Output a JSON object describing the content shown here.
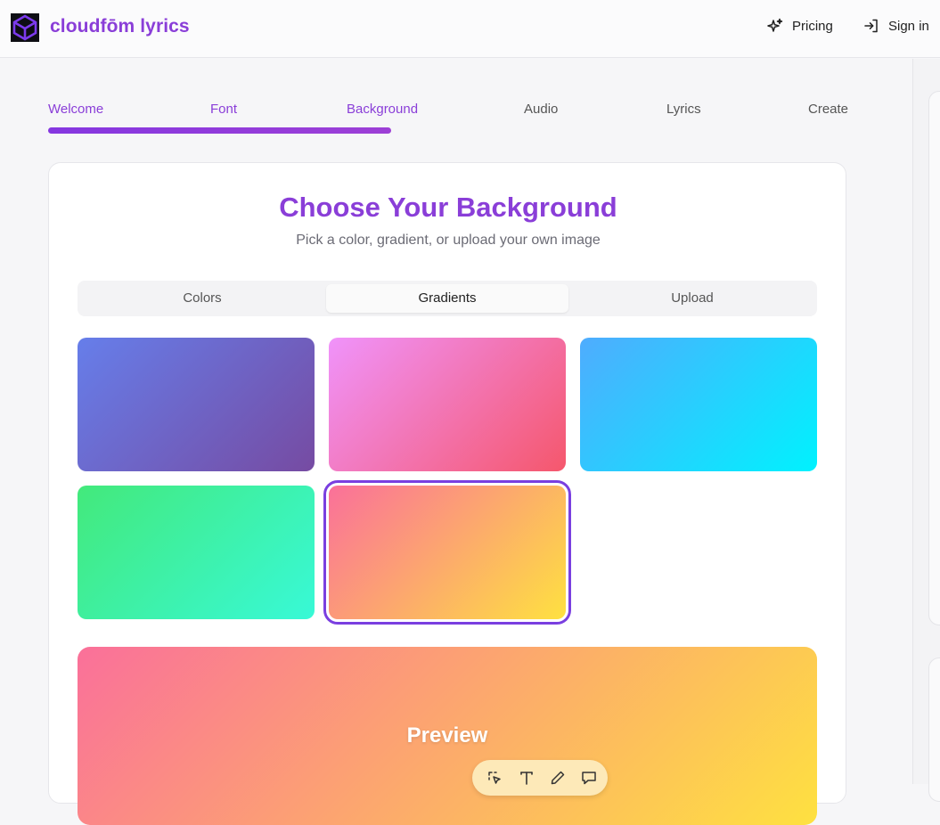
{
  "header": {
    "brand": "cloudfōm lyrics",
    "pricing_label": "Pricing",
    "signin_label": "Sign in"
  },
  "steps": {
    "items": [
      {
        "label": "Welcome",
        "state": "done"
      },
      {
        "label": "Font",
        "state": "done"
      },
      {
        "label": "Background",
        "state": "current"
      },
      {
        "label": "Audio",
        "state": "todo"
      },
      {
        "label": "Lyrics",
        "state": "todo"
      },
      {
        "label": "Create",
        "state": "todo"
      }
    ],
    "progress_fraction": 0.43
  },
  "main": {
    "title": "Choose Your Background",
    "subtitle": "Pick a color, gradient, or upload your own image",
    "tabs": [
      {
        "label": "Colors"
      },
      {
        "label": "Gradients",
        "active": true
      },
      {
        "label": "Upload"
      }
    ],
    "gradients": [
      {
        "from": "#667eea",
        "to": "#764ba2"
      },
      {
        "from": "#f093fb",
        "to": "#f5576c"
      },
      {
        "from": "#4facfe",
        "to": "#00f2fe"
      },
      {
        "from": "#43e97b",
        "to": "#38f9d7"
      },
      {
        "from": "#fa709a",
        "to": "#fee140",
        "selected": true
      }
    ],
    "preview": {
      "label": "Preview",
      "from": "#fa709a",
      "to": "#fee140",
      "tools": [
        "magic-select-icon",
        "text-icon",
        "pencil-icon",
        "comment-icon"
      ]
    }
  },
  "colors": {
    "accent": "#8a3ed8",
    "selected_outline": "#7a3fe0"
  }
}
